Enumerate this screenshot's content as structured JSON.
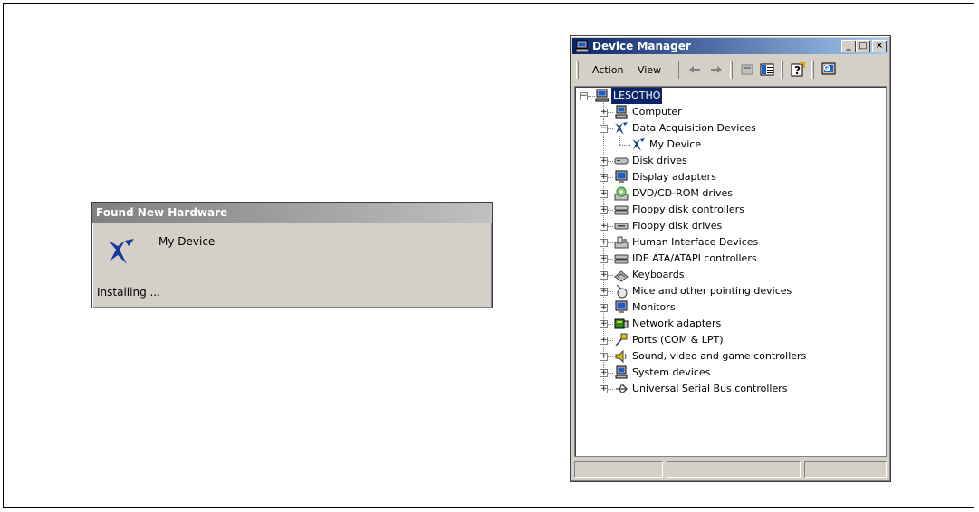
{
  "found_new_hardware": {
    "title": "Found New Hardware",
    "device_name": "My Device",
    "status": "Installing ..."
  },
  "device_manager": {
    "title": "Device Manager",
    "window_buttons": {
      "minimize": "_",
      "maximize": "□",
      "close": "×"
    },
    "menu": {
      "action": "Action",
      "view": "View"
    },
    "toolbar_icons": [
      "back-arrow-icon",
      "forward-arrow-icon",
      "properties-icon",
      "view-icon",
      "help-icon",
      "scan-hardware-icon"
    ],
    "root": "LESOTHO",
    "categories": [
      {
        "label": "Computer",
        "icon": "computer-icon",
        "expanded": false
      },
      {
        "label": "Data Acquisition Devices",
        "icon": "ni-logo-icon",
        "expanded": true,
        "children": [
          "My Device"
        ]
      },
      {
        "label": "Disk drives",
        "icon": "disk-drive-icon",
        "expanded": false
      },
      {
        "label": "Display adapters",
        "icon": "display-icon",
        "expanded": false
      },
      {
        "label": "DVD/CD-ROM drives",
        "icon": "cdrom-icon",
        "expanded": false
      },
      {
        "label": "Floppy disk controllers",
        "icon": "controller-icon",
        "expanded": false
      },
      {
        "label": "Floppy disk drives",
        "icon": "floppy-icon",
        "expanded": false
      },
      {
        "label": "Human Interface Devices",
        "icon": "hid-icon",
        "expanded": false
      },
      {
        "label": "IDE ATA/ATAPI controllers",
        "icon": "controller-icon",
        "expanded": false
      },
      {
        "label": "Keyboards",
        "icon": "keyboard-icon",
        "expanded": false
      },
      {
        "label": "Mice and other pointing devices",
        "icon": "mouse-icon",
        "expanded": false
      },
      {
        "label": "Monitors",
        "icon": "monitor-icon",
        "expanded": false
      },
      {
        "label": "Network adapters",
        "icon": "network-icon",
        "expanded": false
      },
      {
        "label": "Ports (COM & LPT)",
        "icon": "port-icon",
        "expanded": false
      },
      {
        "label": "Sound, video and game controllers",
        "icon": "sound-icon",
        "expanded": false
      },
      {
        "label": "System devices",
        "icon": "system-icon",
        "expanded": false
      },
      {
        "label": "Universal Serial Bus controllers",
        "icon": "usb-icon",
        "expanded": false
      }
    ],
    "colors": {
      "titlebar_start": "#0a246a",
      "titlebar_end": "#a6caf0",
      "selection": "#0a246a",
      "face": "#d4d0c8",
      "ni_blue": "#1a3a9c"
    }
  }
}
